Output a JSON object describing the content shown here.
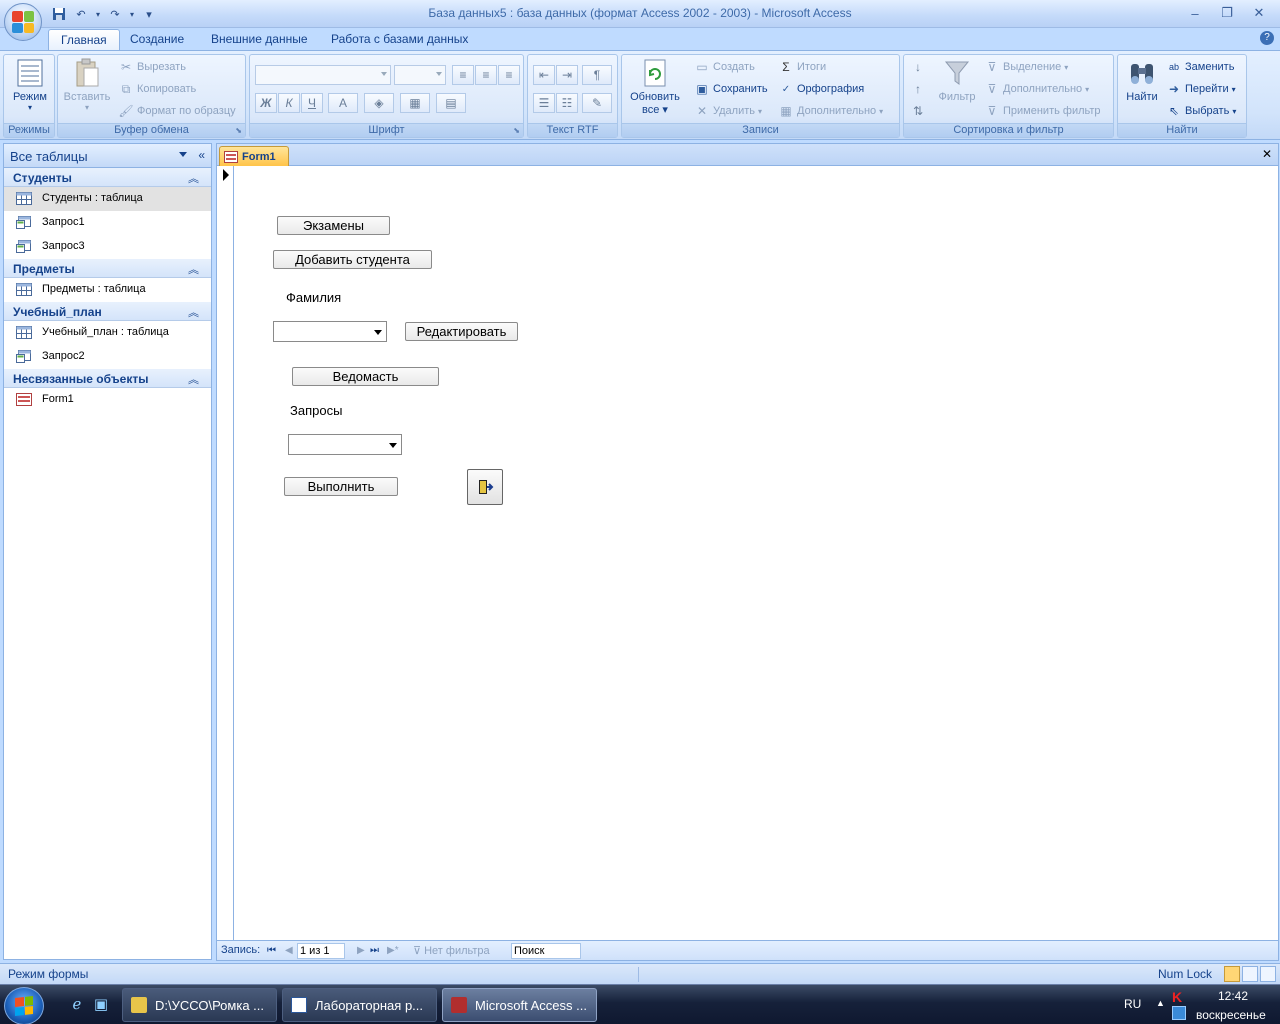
{
  "window": {
    "title": "База данных5 : база данных (формат Access 2002 - 2003) - Microsoft Access",
    "minimize": "–",
    "restore": "❐",
    "close": "✕"
  },
  "qat": {
    "save": "💾",
    "undo": "↶",
    "redo": "↷",
    "customize": "▾"
  },
  "ribbon_tabs": [
    "Главная",
    "Создание",
    "Внешние данные",
    "Работа с базами данных"
  ],
  "ribbon_help": "?",
  "ribbon": {
    "views": {
      "label": "Режимы",
      "mode": "Режим"
    },
    "clipboard": {
      "label": "Буфер обмена",
      "paste": "Вставить",
      "cut": "Вырезать",
      "copy": "Копировать",
      "format_painter": "Формат по образцу"
    },
    "font": {
      "label": "Шрифт",
      "bold": "Ж",
      "italic": "К",
      "underline": "Ч",
      "font_color": "A"
    },
    "rtf": {
      "label": "Текст RTF"
    },
    "records": {
      "label": "Записи",
      "refresh_all_1": "Обновить",
      "refresh_all_2": "все",
      "new": "Создать",
      "save": "Сохранить",
      "delete": "Удалить",
      "totals": "Итоги",
      "spelling": "Орфография",
      "more": "Дополнительно"
    },
    "sort_filter": {
      "label": "Сортировка и фильтр",
      "filter": "Фильтр",
      "selection": "Выделение",
      "advanced": "Дополнительно",
      "toggle_filter": "Применить фильтр"
    },
    "find": {
      "label": "Найти",
      "find": "Найти",
      "replace": "Заменить",
      "goto": "Перейти",
      "select": "Выбрать"
    }
  },
  "nav": {
    "title": "Все таблицы",
    "groups": [
      {
        "label": "Студенты",
        "items": [
          {
            "label": "Студенты : таблица",
            "type": "table",
            "selected": true
          },
          {
            "label": "Запрос1",
            "type": "query"
          },
          {
            "label": "Запрос3",
            "type": "query"
          }
        ]
      },
      {
        "label": "Предметы",
        "items": [
          {
            "label": "Предметы : таблица",
            "type": "table"
          }
        ]
      },
      {
        "label": "Учебный_план",
        "items": [
          {
            "label": "Учебный_план : таблица",
            "type": "table"
          },
          {
            "label": "Запрос2",
            "type": "query"
          }
        ]
      },
      {
        "label": "Несвязанные объекты",
        "items": [
          {
            "label": "Form1",
            "type": "form"
          }
        ]
      }
    ]
  },
  "document": {
    "tab_label": "Form1",
    "close": "✕"
  },
  "form": {
    "exams_button": "Экзамены",
    "add_student_button": "Добавить студента",
    "surname_label": "Фамилия",
    "surname_value": "",
    "edit_button": "Редактировать",
    "statement_button": "Ведомасть",
    "queries_label": "Запросы",
    "queries_value": "",
    "run_button": "Выполнить"
  },
  "record_nav": {
    "label": "Запись:",
    "position": "1 из 1",
    "filter": "Нет фильтра",
    "search": "Поиск"
  },
  "status": {
    "mode": "Режим формы",
    "numlock": "Num Lock"
  },
  "taskbar": {
    "tasks": [
      "D:\\УССО\\Ромка ...",
      "Лабораторная р...",
      "Microsoft Access ..."
    ],
    "lang": "RU",
    "time": "12:42",
    "day": "воскресенье"
  }
}
